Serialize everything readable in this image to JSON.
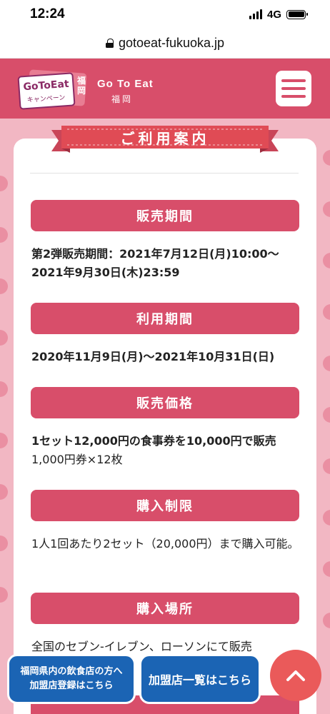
{
  "status_bar": {
    "time": "12:24",
    "network": "4G"
  },
  "browser": {
    "url": "gotoeat-fukuoka.jp"
  },
  "header": {
    "logo_main": "GoToEat",
    "logo_sub": "キャンペーン",
    "logo_city": "福岡",
    "brand_title": "Go To Eat",
    "brand_sub": "福岡"
  },
  "page": {
    "ribbon_title": "ご利用案内"
  },
  "sections": [
    {
      "heading": "販売期間",
      "lines": [
        {
          "text": "第2弾販売期間：2021年7月12日(月)10:00〜2021年9月30日(木)23:59",
          "bold": true
        }
      ]
    },
    {
      "heading": "利用期間",
      "lines": [
        {
          "text": "2020年11月9日(月)〜2021年10月31日(日)",
          "bold": true
        }
      ]
    },
    {
      "heading": "販売価格",
      "lines": [
        {
          "text": "1セット12,000円の食事券を10,000円で販売",
          "bold": true
        },
        {
          "text": "1,000円券×12枚",
          "bold": false
        }
      ]
    },
    {
      "heading": "購入制限",
      "lines": [
        {
          "text": "1人1回あたり2セット（20,000円）まで購入可能。",
          "bold": false
        }
      ]
    },
    {
      "heading": "購入場所",
      "lines": [
        {
          "text": "全国のセブン-イレブン、ローソンにて販売",
          "bold": false
        }
      ]
    }
  ],
  "floating": {
    "register_line1": "福岡県内の飲食店の方へ",
    "register_line2": "加盟店登録はこちら",
    "store_list": "加盟店一覧はこちら"
  },
  "colors": {
    "brand": "#d84e6a",
    "background": "#f2b7c3",
    "float_button": "#1b64b4",
    "scroll_top": "#ea5a5a"
  },
  "icons": [
    "lock-icon",
    "hamburger-menu-icon",
    "chevron-up-icon"
  ]
}
